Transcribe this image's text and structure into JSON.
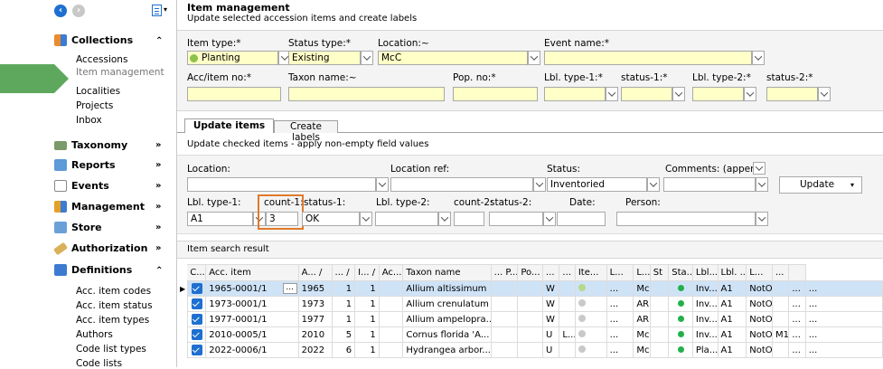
{
  "sidebar": {
    "collections": {
      "label": "Collections",
      "items": [
        "Accessions",
        "Item management",
        "Localities",
        "Projects",
        "Inbox"
      ]
    },
    "sections": [
      {
        "label": "Taxonomy",
        "name": "taxonomy"
      },
      {
        "label": "Reports",
        "name": "reports"
      },
      {
        "label": "Events",
        "name": "events"
      },
      {
        "label": "Management",
        "name": "management"
      },
      {
        "label": "Store",
        "name": "store"
      },
      {
        "label": "Authorization",
        "name": "authorization"
      }
    ],
    "definitions": {
      "label": "Definitions",
      "items": [
        "Acc. item codes",
        "Acc. item status",
        "Acc. item types",
        "Authors",
        "Code list types",
        "Code lists"
      ]
    }
  },
  "header": {
    "title": "Item management",
    "subtitle": "Update selected accession items and create labels"
  },
  "filters": {
    "item_type_label": "Item type:*",
    "item_type_value": "Planting",
    "status_type_label": "Status type:*",
    "status_type_value": "Existing",
    "location_label": "Location:~",
    "location_value": "McC",
    "event_name_label": "Event name:*",
    "acc_item_no_label": "Acc/item no:*",
    "taxon_name_label": "Taxon name:~",
    "pop_no_label": "Pop. no:*",
    "lbl_type1_label": "Lbl. type-1:*",
    "status1_label": "status-1:*",
    "lbl_type2_label": "Lbl. type-2:*",
    "status2_label": "status-2:*"
  },
  "tabs": {
    "update": "Update items",
    "create": "Create labels"
  },
  "update": {
    "hint": "Update checked items - apply non-empty field values",
    "location_label": "Location:",
    "location_ref_label": "Location ref:",
    "status_label": "Status:",
    "status_value": "Inventoried",
    "comments_label": "Comments: (append)",
    "update_button": "Update",
    "lbl_type1_label": "Lbl. type-1:",
    "lbl_type1_value": "A1",
    "count1_label": "count-1:",
    "count1_value": "3",
    "status1_label": "status-1:",
    "status1_value": "OK",
    "lbl_type2_label": "Lbl. type-2:",
    "count2_label": "count-2:",
    "status2_label": "status-2:",
    "date_label": "Date:",
    "person_label": "Person:"
  },
  "results": {
    "title": "Item search result",
    "columns": [
      "C...",
      "Acc. item",
      "A... /",
      "... /",
      "I... /",
      "Ac...",
      "Taxon name",
      "... P...",
      "Po...",
      "...",
      "...",
      "Ite...",
      "L...",
      "L...",
      "St",
      "Sta...",
      "Lbl...",
      "Lbl. ...",
      "L...",
      "...",
      ""
    ],
    "rows": [
      [
        "1965-0001/1",
        "1965",
        "1",
        "1",
        "Allium altissimum",
        "W",
        "...",
        "McC",
        "Inv...",
        "A1",
        "NotOK",
        ""
      ],
      [
        "1973-0001/1",
        "1973",
        "1",
        "1",
        "Allium crenulatum",
        "W",
        "...",
        "ARB",
        "Inv...",
        "A1",
        "NotOK",
        ""
      ],
      [
        "1977-0001/1",
        "1977",
        "1",
        "1",
        "Allium ampelopra...",
        "W",
        "...",
        "ARB",
        "Inv...",
        "A1",
        "NotOK",
        ""
      ],
      [
        "2010-0005/1",
        "2010",
        "5",
        "1",
        "Cornus florida 'A...",
        "U",
        "...",
        "McC",
        "Inv...",
        "A1",
        "NotOK",
        "M1"
      ],
      [
        "2022-0006/1",
        "2022",
        "6",
        "1",
        "Hydrangea arbor...",
        "U",
        "...",
        "McC",
        "Pla...",
        "A1",
        "NotOK",
        ""
      ]
    ],
    "row4_extra": "L..."
  },
  "colors": {
    "accent": "#1e6fd0",
    "selection": "#cfe3f7",
    "highlight_box": "#e07a2c",
    "nav_arrow": "#5ea85e",
    "status_ok": "#22b04b"
  }
}
